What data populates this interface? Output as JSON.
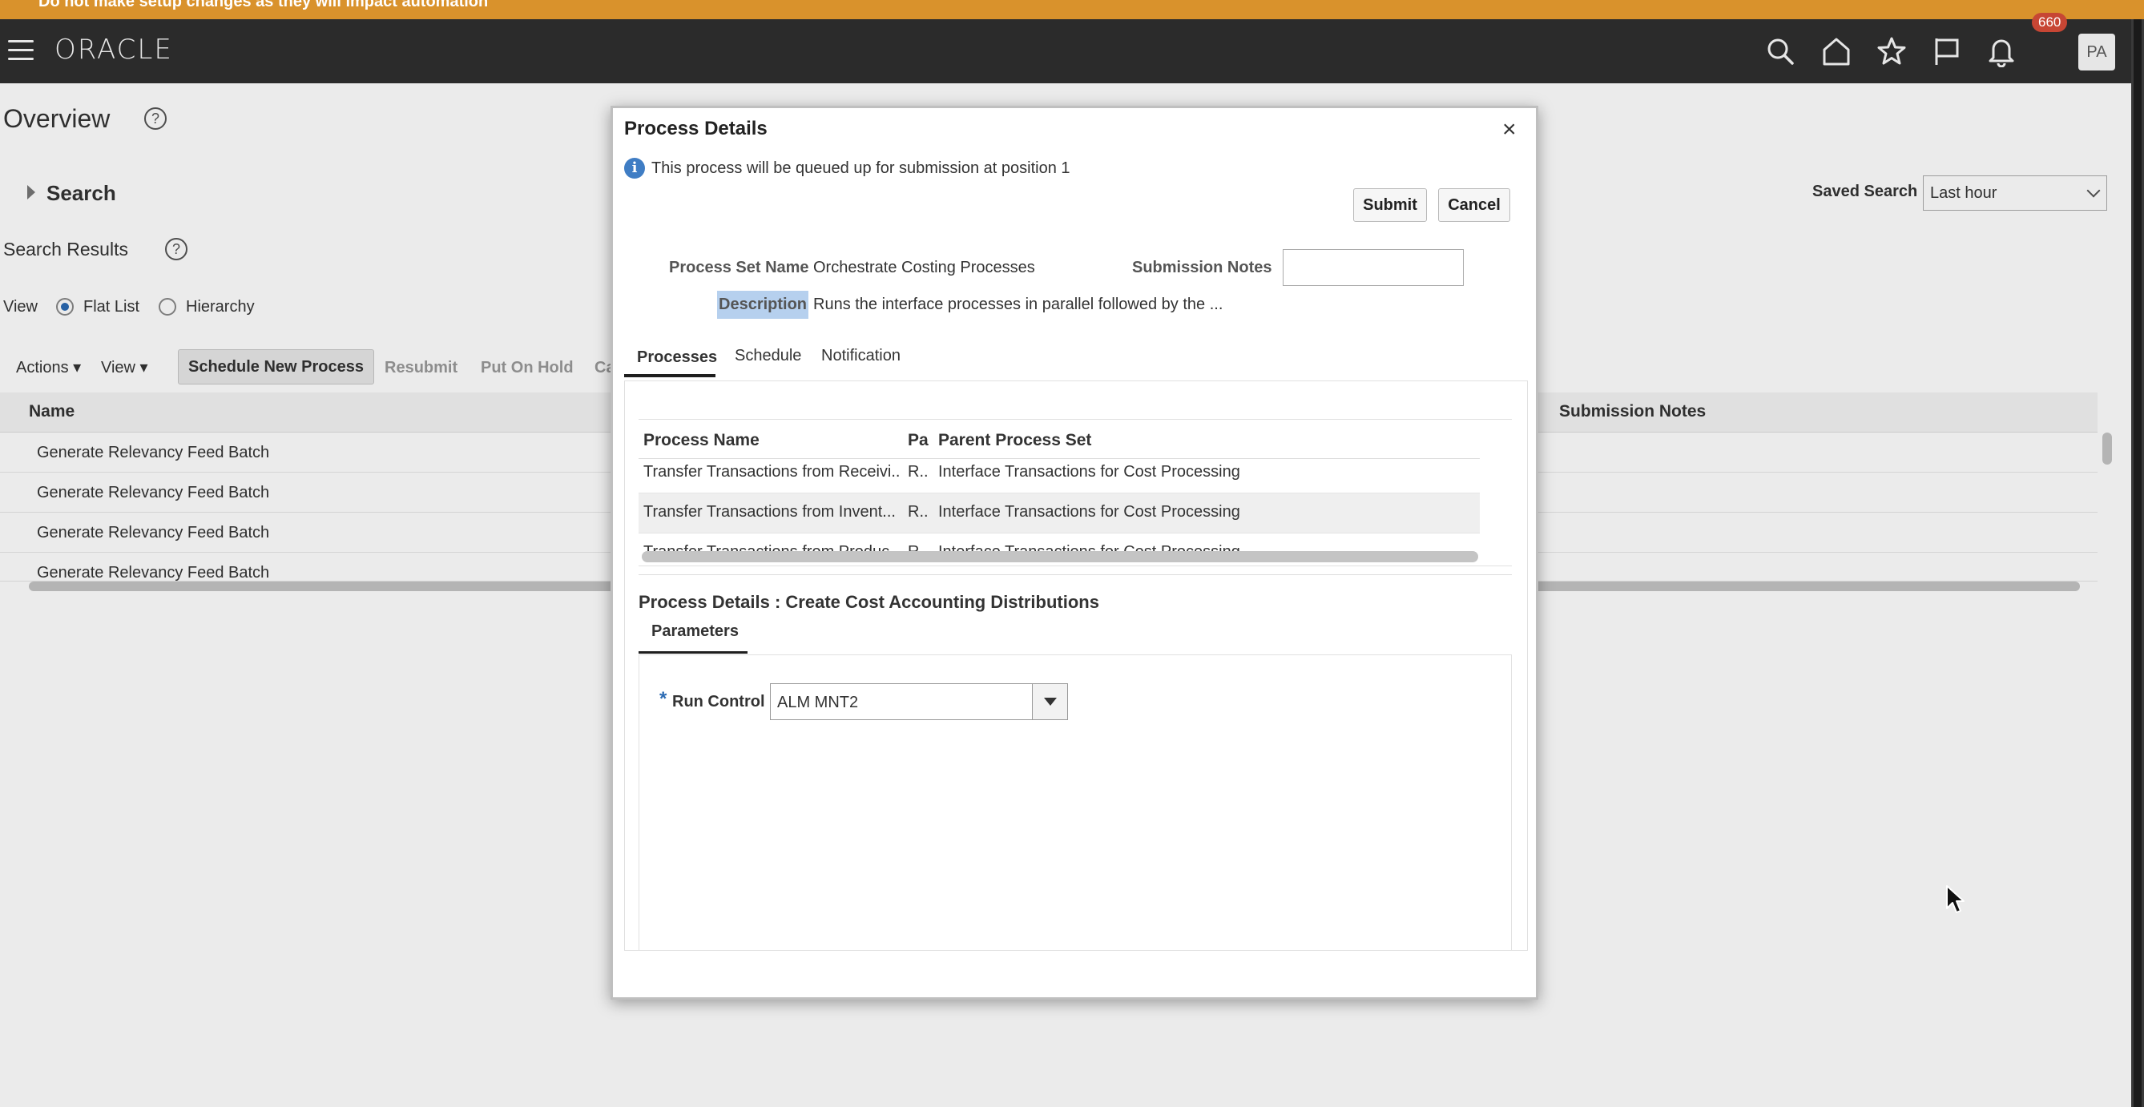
{
  "banner": {
    "text": "Do not make setup changes as they will impact automation"
  },
  "header": {
    "logo": "ORACLE",
    "notification_count": "660",
    "avatar_initials": "PA"
  },
  "page": {
    "title": "Overview",
    "search_label": "Search",
    "results_label": "Search Results",
    "view_label": "View",
    "view_options": [
      "Flat List",
      "Hierarchy"
    ],
    "view_selected": "Flat List",
    "saved_search_label": "Saved Search",
    "saved_search_value": "Last hour",
    "toolbar": {
      "actions": "Actions",
      "view": "View",
      "schedule": "Schedule New Process",
      "resubmit": "Resubmit",
      "put_on_hold": "Put On Hold",
      "cancel_trunc": "Ca"
    },
    "grid": {
      "columns": [
        "Name",
        "Submission Notes"
      ],
      "rows": [
        "Generate Relevancy Feed Batch",
        "Generate Relevancy Feed Batch",
        "Generate Relevancy Feed Batch",
        "Generate Relevancy Feed Batch"
      ]
    }
  },
  "dialog": {
    "title": "Process Details",
    "close": "×",
    "info_message": "This process will be queued up for submission at position 1",
    "submit": "Submit",
    "cancel": "Cancel",
    "process_set_name_label": "Process Set Name",
    "process_set_name_value": "Orchestrate Costing Processes",
    "submission_notes_label": "Submission Notes",
    "submission_notes_value": "",
    "description_label": "Description",
    "description_value": "Runs the interface processes in parallel followed by the ...",
    "tabs": [
      "Processes",
      "Schedule",
      "Notification"
    ],
    "active_tab": "Processes",
    "process_table": {
      "columns": [
        "Process Name",
        "Pa",
        "Parent Process Set"
      ],
      "rows": [
        {
          "name": "Transfer Transactions from Receivi...",
          "pa": "R..",
          "parent": "Interface Transactions for Cost Processing"
        },
        {
          "name": "Transfer Transactions from Invent...",
          "pa": "R..",
          "parent": "Interface Transactions for Cost Processing"
        },
        {
          "name": "Transfer Transactions from Produc...",
          "pa": "R..",
          "parent": "Interface Transactions for Cost Processing"
        }
      ]
    },
    "details_title": "Process Details : Create Cost Accounting Distributions",
    "details_tab": "Parameters",
    "run_control_label": "Run Control",
    "run_control_value": "ALM MNT2",
    "required_mark": "*"
  },
  "icons": {
    "menu": "hamburger-icon",
    "search": "search-icon",
    "home": "home-icon",
    "favorites": "star-icon",
    "flag": "flag-icon",
    "notifications": "bell-icon",
    "info": "info-icon"
  },
  "colors": {
    "banner": "#d9922c",
    "header": "#2b2b2b",
    "badge": "#c74634",
    "accent": "#2c6bb3"
  }
}
